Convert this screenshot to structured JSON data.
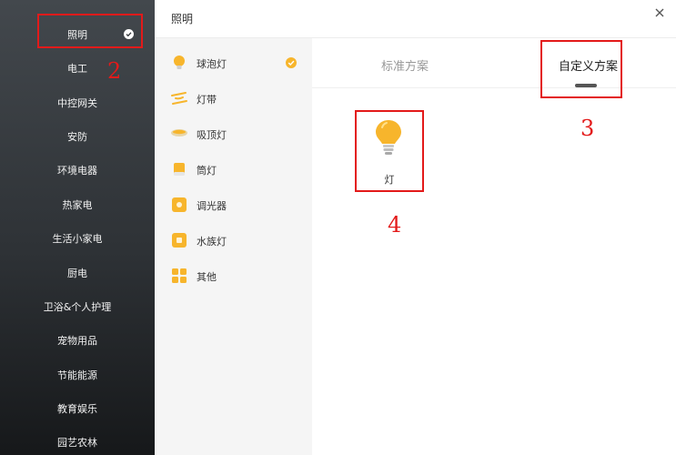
{
  "header": {
    "title": "照明",
    "close_glyph": "×"
  },
  "sidebar": {
    "items": [
      {
        "label": "照明",
        "selected": true
      },
      {
        "label": "电工"
      },
      {
        "label": "中控网关"
      },
      {
        "label": "安防"
      },
      {
        "label": "环境电器"
      },
      {
        "label": "热家电"
      },
      {
        "label": "生活小家电"
      },
      {
        "label": "厨电"
      },
      {
        "label": "卫浴&个人护理"
      },
      {
        "label": "宠物用品"
      },
      {
        "label": "节能能源"
      },
      {
        "label": "教育娱乐"
      },
      {
        "label": "园艺农林"
      }
    ]
  },
  "subnav": {
    "items": [
      {
        "label": "球泡灯",
        "icon": "bulb-icon",
        "selected": true
      },
      {
        "label": "灯带",
        "icon": "light-strip-icon"
      },
      {
        "label": "吸顶灯",
        "icon": "ceiling-light-icon"
      },
      {
        "label": "筒灯",
        "icon": "downlight-icon"
      },
      {
        "label": "调光器",
        "icon": "dimmer-icon"
      },
      {
        "label": "水族灯",
        "icon": "aquarium-light-icon"
      },
      {
        "label": "其他",
        "icon": "grid-icon"
      }
    ]
  },
  "tabs": {
    "standard": "标准方案",
    "custom": "自定义方案",
    "active": "custom"
  },
  "devices": [
    {
      "name": "灯",
      "icon": "bulb-icon"
    }
  ],
  "annotations": {
    "n2": "2",
    "n3": "3",
    "n4": "4"
  },
  "colors": {
    "accent": "#f7b52c",
    "annotation": "#e31a1a",
    "sidebar": "#2e3236"
  }
}
